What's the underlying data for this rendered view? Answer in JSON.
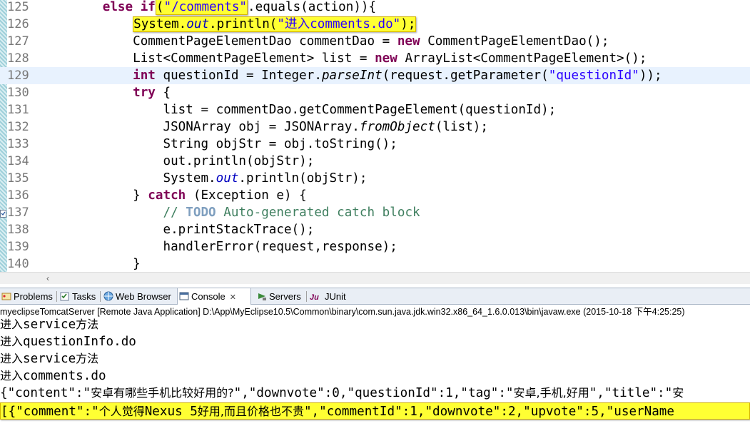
{
  "editor": {
    "lines": [
      {
        "num": "125",
        "segments": [
          {
            "t": "        "
          },
          {
            "t": "else",
            "c": "kw"
          },
          {
            "t": " "
          },
          {
            "t": "if",
            "c": "kw"
          },
          {
            "t": "(",
            "c": "box1"
          },
          {
            "t": "\"/comments\"",
            "c": "str box1"
          },
          {
            "t": ".equals(action)){"
          }
        ]
      },
      {
        "num": "126",
        "segments": [
          {
            "t": "            "
          },
          {
            "t": "System.",
            "c": "box2"
          },
          {
            "t": "out",
            "c": "fld box2"
          },
          {
            "t": ".println(",
            "c": "box2"
          },
          {
            "t": "\"进入comments.do\"",
            "c": "str box2"
          },
          {
            "t": ");",
            "c": "box2"
          }
        ]
      },
      {
        "num": "127",
        "segments": [
          {
            "t": "            CommentPageElementDao commentDao = "
          },
          {
            "t": "new",
            "c": "kw"
          },
          {
            "t": " CommentPageElementDao();"
          }
        ]
      },
      {
        "num": "128",
        "segments": [
          {
            "t": "            List<CommentPageElement> list = "
          },
          {
            "t": "new",
            "c": "kw"
          },
          {
            "t": " ArrayList<CommentPageElement>();"
          }
        ]
      },
      {
        "num": "129",
        "current": true,
        "segments": [
          {
            "t": "            "
          },
          {
            "t": "int",
            "c": "kw"
          },
          {
            "t": " questionId = Integer."
          },
          {
            "t": "parseInt",
            "c": "sm"
          },
          {
            "t": "(request.getParameter("
          },
          {
            "t": "\"questionId\"",
            "c": "str"
          },
          {
            "t": "));"
          }
        ]
      },
      {
        "num": "130",
        "segments": [
          {
            "t": "            "
          },
          {
            "t": "try",
            "c": "kw"
          },
          {
            "t": " {"
          }
        ]
      },
      {
        "num": "131",
        "segments": [
          {
            "t": "                list = commentDao.getCommentPageElement(questionId);"
          }
        ]
      },
      {
        "num": "132",
        "segments": [
          {
            "t": "                JSONArray obj = JSONArray."
          },
          {
            "t": "fromObject",
            "c": "sm"
          },
          {
            "t": "(list);"
          }
        ]
      },
      {
        "num": "133",
        "segments": [
          {
            "t": "                String objStr = obj.toString();"
          }
        ]
      },
      {
        "num": "134",
        "segments": [
          {
            "t": "                out.println(objStr);"
          }
        ]
      },
      {
        "num": "135",
        "segments": [
          {
            "t": "                System."
          },
          {
            "t": "out",
            "c": "fld"
          },
          {
            "t": ".println(objStr);"
          }
        ]
      },
      {
        "num": "136",
        "segments": [
          {
            "t": "            } "
          },
          {
            "t": "catch",
            "c": "kw"
          },
          {
            "t": " (Exception e) {"
          }
        ]
      },
      {
        "num": "137",
        "marker": true,
        "segments": [
          {
            "t": "                "
          },
          {
            "t": "// ",
            "c": "cm"
          },
          {
            "t": "TODO",
            "c": "todo"
          },
          {
            "t": " Auto-generated catch block",
            "c": "cm"
          }
        ]
      },
      {
        "num": "138",
        "segments": [
          {
            "t": "                e.printStackTrace();"
          }
        ]
      },
      {
        "num": "139",
        "segments": [
          {
            "t": "                handlerError(request,response);"
          }
        ]
      },
      {
        "num": "140",
        "segments": [
          {
            "t": "            }"
          }
        ]
      }
    ],
    "scroll_left_glyph": "‹"
  },
  "tabs": {
    "problems": "Problems",
    "tasks": "Tasks",
    "web_browser": "Web Browser",
    "console": "Console",
    "console_close": "✕",
    "servers": "Servers",
    "junit": "JUnit"
  },
  "console": {
    "header": "myeclipseTomcatServer [Remote Java Application] D:\\App\\MyEclipse10.5\\Common\\binary\\com.sun.java.jdk.win32.x86_64_1.6.0.013\\bin\\javaw.exe (2015-10-18 下午4:25:25)",
    "lines": [
      {
        "segments": [
          {
            "t": "进入",
            "c": "zh"
          },
          {
            "t": "service"
          },
          {
            "t": "方法",
            "c": "zh"
          }
        ]
      },
      {
        "segments": [
          {
            "t": "进入",
            "c": "zh"
          },
          {
            "t": "questionInfo.do"
          }
        ]
      },
      {
        "segments": [
          {
            "t": "进入",
            "c": "zh"
          },
          {
            "t": "service"
          },
          {
            "t": "方法",
            "c": "zh"
          }
        ]
      },
      {
        "segments": [
          {
            "t": "进入",
            "c": "zh"
          },
          {
            "t": "comments.do"
          }
        ]
      },
      {
        "segments": [
          {
            "t": "{\"content\":\""
          },
          {
            "t": "安卓有哪些手机比较好用的?",
            "c": "zh"
          },
          {
            "t": "\",\"downvote\":0,\"questionId\":1,\"tag\":\""
          },
          {
            "t": "安卓,手机,好用",
            "c": "zh"
          },
          {
            "t": "\",\"title\":\""
          },
          {
            "t": "安",
            "c": "zh"
          }
        ]
      },
      {
        "highlight": true,
        "segments": [
          {
            "t": "[{\"comment\":\""
          },
          {
            "t": "个人觉得",
            "c": "zh"
          },
          {
            "t": "Nexus 5"
          },
          {
            "t": "好用,而且价格也不贵",
            "c": "zh"
          },
          {
            "t": "\",\"commentId\":1,\"downvote\":2,\"upvote\":5,\"userName"
          }
        ]
      }
    ]
  }
}
